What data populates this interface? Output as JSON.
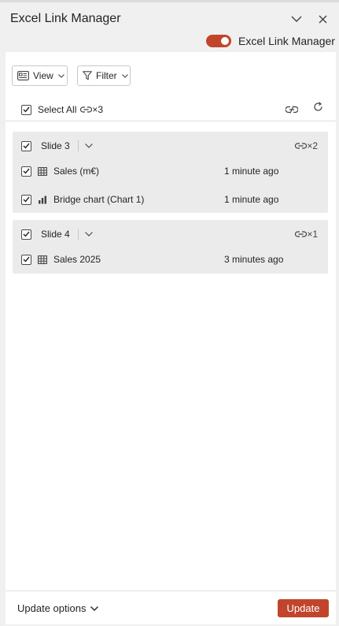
{
  "header": {
    "title": "Excel Link Manager",
    "collapse_icon": "chevron-down-icon",
    "close_icon": "close-icon"
  },
  "toggle": {
    "label": "Excel Link Manager",
    "on": true,
    "color": "#c0452b"
  },
  "toolbar": {
    "view_label": "View",
    "filter_label": "Filter"
  },
  "select_all": {
    "label": "Select All",
    "link_count": "×3",
    "checked": true
  },
  "groups": [
    {
      "label": "Slide 3",
      "link_count": "×2",
      "checked": true,
      "items": [
        {
          "icon": "table-icon",
          "label": "Sales (m€)",
          "time": "1 minute ago",
          "checked": true
        },
        {
          "icon": "bar-chart-icon",
          "label": "Bridge chart (Chart 1)",
          "time": "1 minute ago",
          "checked": true
        }
      ]
    },
    {
      "label": "Slide 4",
      "link_count": "×1",
      "checked": true,
      "items": [
        {
          "icon": "table-icon",
          "label": "Sales 2025",
          "time": "3 minutes ago",
          "checked": true
        }
      ]
    }
  ],
  "footer": {
    "update_options_label": "Update options",
    "update_button_label": "Update",
    "accent": "#c0452b"
  }
}
